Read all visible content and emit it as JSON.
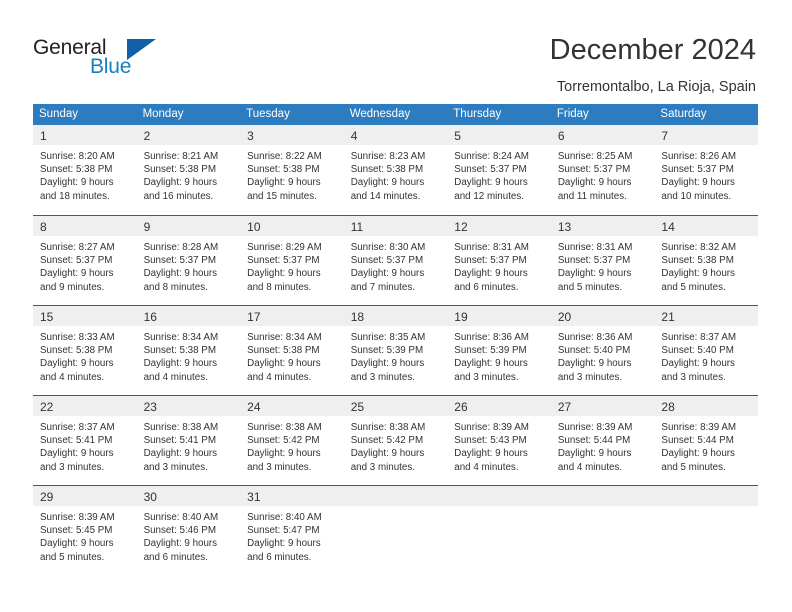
{
  "logo": {
    "text_primary": "General",
    "text_secondary": "Blue",
    "triangle_color": "#1061a8",
    "secondary_color": "#1a7fc1"
  },
  "header": {
    "title": "December 2024",
    "subtitle": "Torremontalbo, La Rioja, Spain"
  },
  "theme": {
    "header_bar_color": "#2e7cc0",
    "week_rule_color": "#1665ad",
    "daynum_band_color": "#efefef",
    "text_color": "#333333"
  },
  "weekdays": [
    "Sunday",
    "Monday",
    "Tuesday",
    "Wednesday",
    "Thursday",
    "Friday",
    "Saturday"
  ],
  "weeks": [
    [
      {
        "day": "1",
        "sunrise": "Sunrise: 8:20 AM",
        "sunset": "Sunset: 5:38 PM",
        "daylight1": "Daylight: 9 hours",
        "daylight2": "and 18 minutes."
      },
      {
        "day": "2",
        "sunrise": "Sunrise: 8:21 AM",
        "sunset": "Sunset: 5:38 PM",
        "daylight1": "Daylight: 9 hours",
        "daylight2": "and 16 minutes."
      },
      {
        "day": "3",
        "sunrise": "Sunrise: 8:22 AM",
        "sunset": "Sunset: 5:38 PM",
        "daylight1": "Daylight: 9 hours",
        "daylight2": "and 15 minutes."
      },
      {
        "day": "4",
        "sunrise": "Sunrise: 8:23 AM",
        "sunset": "Sunset: 5:38 PM",
        "daylight1": "Daylight: 9 hours",
        "daylight2": "and 14 minutes."
      },
      {
        "day": "5",
        "sunrise": "Sunrise: 8:24 AM",
        "sunset": "Sunset: 5:37 PM",
        "daylight1": "Daylight: 9 hours",
        "daylight2": "and 12 minutes."
      },
      {
        "day": "6",
        "sunrise": "Sunrise: 8:25 AM",
        "sunset": "Sunset: 5:37 PM",
        "daylight1": "Daylight: 9 hours",
        "daylight2": "and 11 minutes."
      },
      {
        "day": "7",
        "sunrise": "Sunrise: 8:26 AM",
        "sunset": "Sunset: 5:37 PM",
        "daylight1": "Daylight: 9 hours",
        "daylight2": "and 10 minutes."
      }
    ],
    [
      {
        "day": "8",
        "sunrise": "Sunrise: 8:27 AM",
        "sunset": "Sunset: 5:37 PM",
        "daylight1": "Daylight: 9 hours",
        "daylight2": "and 9 minutes."
      },
      {
        "day": "9",
        "sunrise": "Sunrise: 8:28 AM",
        "sunset": "Sunset: 5:37 PM",
        "daylight1": "Daylight: 9 hours",
        "daylight2": "and 8 minutes."
      },
      {
        "day": "10",
        "sunrise": "Sunrise: 8:29 AM",
        "sunset": "Sunset: 5:37 PM",
        "daylight1": "Daylight: 9 hours",
        "daylight2": "and 8 minutes."
      },
      {
        "day": "11",
        "sunrise": "Sunrise: 8:30 AM",
        "sunset": "Sunset: 5:37 PM",
        "daylight1": "Daylight: 9 hours",
        "daylight2": "and 7 minutes."
      },
      {
        "day": "12",
        "sunrise": "Sunrise: 8:31 AM",
        "sunset": "Sunset: 5:37 PM",
        "daylight1": "Daylight: 9 hours",
        "daylight2": "and 6 minutes."
      },
      {
        "day": "13",
        "sunrise": "Sunrise: 8:31 AM",
        "sunset": "Sunset: 5:37 PM",
        "daylight1": "Daylight: 9 hours",
        "daylight2": "and 5 minutes."
      },
      {
        "day": "14",
        "sunrise": "Sunrise: 8:32 AM",
        "sunset": "Sunset: 5:38 PM",
        "daylight1": "Daylight: 9 hours",
        "daylight2": "and 5 minutes."
      }
    ],
    [
      {
        "day": "15",
        "sunrise": "Sunrise: 8:33 AM",
        "sunset": "Sunset: 5:38 PM",
        "daylight1": "Daylight: 9 hours",
        "daylight2": "and 4 minutes."
      },
      {
        "day": "16",
        "sunrise": "Sunrise: 8:34 AM",
        "sunset": "Sunset: 5:38 PM",
        "daylight1": "Daylight: 9 hours",
        "daylight2": "and 4 minutes."
      },
      {
        "day": "17",
        "sunrise": "Sunrise: 8:34 AM",
        "sunset": "Sunset: 5:38 PM",
        "daylight1": "Daylight: 9 hours",
        "daylight2": "and 4 minutes."
      },
      {
        "day": "18",
        "sunrise": "Sunrise: 8:35 AM",
        "sunset": "Sunset: 5:39 PM",
        "daylight1": "Daylight: 9 hours",
        "daylight2": "and 3 minutes."
      },
      {
        "day": "19",
        "sunrise": "Sunrise: 8:36 AM",
        "sunset": "Sunset: 5:39 PM",
        "daylight1": "Daylight: 9 hours",
        "daylight2": "and 3 minutes."
      },
      {
        "day": "20",
        "sunrise": "Sunrise: 8:36 AM",
        "sunset": "Sunset: 5:40 PM",
        "daylight1": "Daylight: 9 hours",
        "daylight2": "and 3 minutes."
      },
      {
        "day": "21",
        "sunrise": "Sunrise: 8:37 AM",
        "sunset": "Sunset: 5:40 PM",
        "daylight1": "Daylight: 9 hours",
        "daylight2": "and 3 minutes."
      }
    ],
    [
      {
        "day": "22",
        "sunrise": "Sunrise: 8:37 AM",
        "sunset": "Sunset: 5:41 PM",
        "daylight1": "Daylight: 9 hours",
        "daylight2": "and 3 minutes."
      },
      {
        "day": "23",
        "sunrise": "Sunrise: 8:38 AM",
        "sunset": "Sunset: 5:41 PM",
        "daylight1": "Daylight: 9 hours",
        "daylight2": "and 3 minutes."
      },
      {
        "day": "24",
        "sunrise": "Sunrise: 8:38 AM",
        "sunset": "Sunset: 5:42 PM",
        "daylight1": "Daylight: 9 hours",
        "daylight2": "and 3 minutes."
      },
      {
        "day": "25",
        "sunrise": "Sunrise: 8:38 AM",
        "sunset": "Sunset: 5:42 PM",
        "daylight1": "Daylight: 9 hours",
        "daylight2": "and 3 minutes."
      },
      {
        "day": "26",
        "sunrise": "Sunrise: 8:39 AM",
        "sunset": "Sunset: 5:43 PM",
        "daylight1": "Daylight: 9 hours",
        "daylight2": "and 4 minutes."
      },
      {
        "day": "27",
        "sunrise": "Sunrise: 8:39 AM",
        "sunset": "Sunset: 5:44 PM",
        "daylight1": "Daylight: 9 hours",
        "daylight2": "and 4 minutes."
      },
      {
        "day": "28",
        "sunrise": "Sunrise: 8:39 AM",
        "sunset": "Sunset: 5:44 PM",
        "daylight1": "Daylight: 9 hours",
        "daylight2": "and 5 minutes."
      }
    ],
    [
      {
        "day": "29",
        "sunrise": "Sunrise: 8:39 AM",
        "sunset": "Sunset: 5:45 PM",
        "daylight1": "Daylight: 9 hours",
        "daylight2": "and 5 minutes."
      },
      {
        "day": "30",
        "sunrise": "Sunrise: 8:40 AM",
        "sunset": "Sunset: 5:46 PM",
        "daylight1": "Daylight: 9 hours",
        "daylight2": "and 6 minutes."
      },
      {
        "day": "31",
        "sunrise": "Sunrise: 8:40 AM",
        "sunset": "Sunset: 5:47 PM",
        "daylight1": "Daylight: 9 hours",
        "daylight2": "and 6 minutes."
      },
      {
        "day": "",
        "sunrise": "",
        "sunset": "",
        "daylight1": "",
        "daylight2": ""
      },
      {
        "day": "",
        "sunrise": "",
        "sunset": "",
        "daylight1": "",
        "daylight2": ""
      },
      {
        "day": "",
        "sunrise": "",
        "sunset": "",
        "daylight1": "",
        "daylight2": ""
      },
      {
        "day": "",
        "sunrise": "",
        "sunset": "",
        "daylight1": "",
        "daylight2": ""
      }
    ]
  ]
}
